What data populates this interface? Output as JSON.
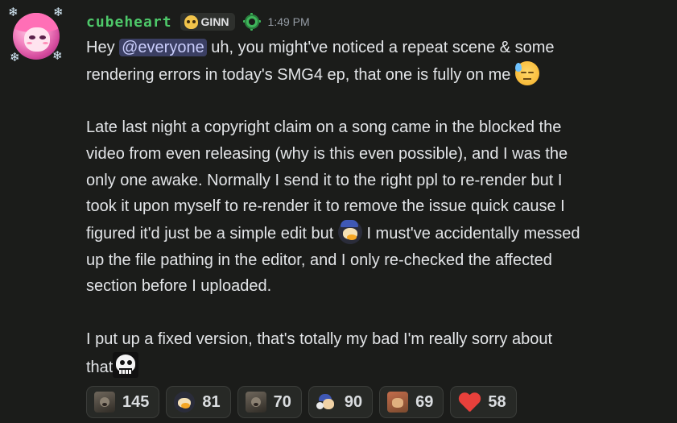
{
  "message": {
    "username": "cubeheart",
    "tag": "GINN",
    "timestamp": "1:49 PM",
    "body": {
      "line1_pre": "Hey ",
      "mention": "@everyone",
      "line1_post": " uh, you might've noticed a repeat scene & some",
      "line2": "rendering errors in today's SMG4 ep, that one is fully on me",
      "para2_a": "Late last night a copyright claim on a song came in the blocked the",
      "para2_b": "video from even releasing (why is this even possible), and I was the",
      "para2_c": "only one awake. Normally I send it to the right ppl to re-render but I",
      "para2_d": "took it upon myself to re-render it to remove the issue quick cause I",
      "para2_e_pre": "figured it'd just be a simple edit but ",
      "para2_e_post": " I must've accidentally messed",
      "para2_f": "up the file pathing in the editor, and I only re-checked the affected",
      "para2_g": "section before I uploaded.",
      "para3_a": "I put up a fixed version, that's totally my bad I'm really sorry about",
      "para3_b": "that"
    },
    "emojis": [
      "sweat-smile-icon",
      "penguin-icon",
      "skull-icon"
    ]
  },
  "reactions": [
    {
      "icon": "bear-icon",
      "count": "145"
    },
    {
      "icon": "penguin-icon",
      "count": "81"
    },
    {
      "icon": "bear-icon",
      "count": "70"
    },
    {
      "icon": "mascot-icon",
      "count": "90"
    },
    {
      "icon": "dog-icon",
      "count": "69"
    },
    {
      "icon": "heart-icon",
      "count": "58",
      "color": "#e8403b"
    }
  ],
  "colors": {
    "background": "#1b1c1a",
    "username": "#4ec96a",
    "mention_bg": "#3b3f63",
    "mention_text": "#c9cdfb",
    "timestamp": "#949ba4"
  }
}
